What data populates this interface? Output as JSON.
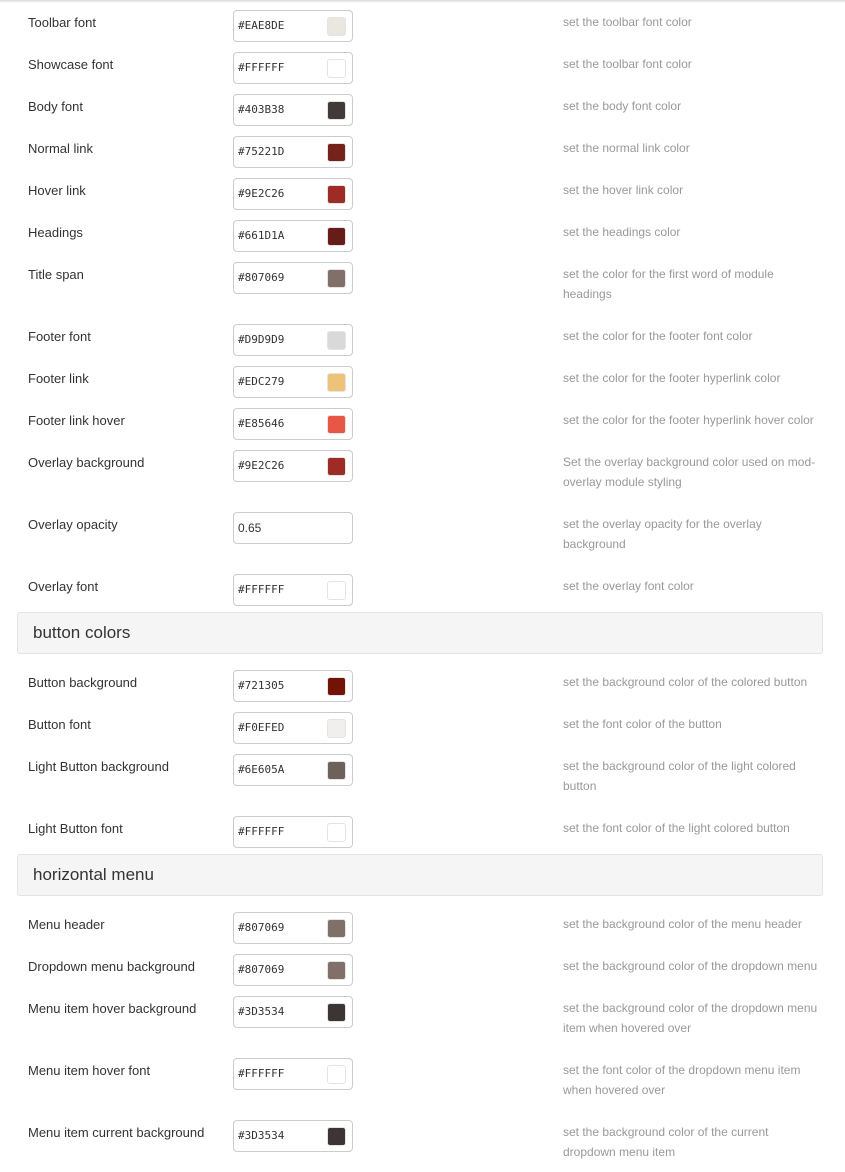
{
  "sections": [
    {
      "title": "",
      "rows": [
        {
          "label": "Toolbar font",
          "value": "#EAE8DE",
          "swatch": "#EAE8DE",
          "desc": "set the toolbar font color"
        },
        {
          "label": "Showcase font",
          "value": "#FFFFFF",
          "swatch": "#FFFFFF",
          "desc": "set the toolbar font color"
        },
        {
          "label": "Body font",
          "value": "#403B38",
          "swatch": "#403B38",
          "desc": "set the body font color"
        },
        {
          "label": "Normal link",
          "value": "#75221D",
          "swatch": "#75221D",
          "desc": "set the normal link color"
        },
        {
          "label": "Hover link",
          "value": "#9E2C26",
          "swatch": "#9E2C26",
          "desc": "set the hover link color"
        },
        {
          "label": "Headings",
          "value": "#661D1A",
          "swatch": "#661D1A",
          "desc": "set the headings color"
        },
        {
          "label": "Title span",
          "value": "#807069",
          "swatch": "#807069",
          "desc": "set the color for the first word of module headings"
        },
        {
          "label": "Footer font",
          "value": "#D9D9D9",
          "swatch": "#D9D9D9",
          "desc": "set the color for the footer font color"
        },
        {
          "label": "Footer link",
          "value": "#EDC279",
          "swatch": "#EDC279",
          "desc": "set the color for the footer hyperlink color"
        },
        {
          "label": "Footer link hover",
          "value": "#E85646",
          "swatch": "#E85646",
          "desc": "set the color for the footer hyperlink hover color"
        },
        {
          "label": "Overlay background",
          "value": "#9E2C26",
          "swatch": "#9E2C26",
          "desc": "Set the overlay background color used on mod-overlay module styling"
        },
        {
          "label": "Overlay opacity",
          "value": "0.65",
          "desc": "set the overlay opacity for the overlay background"
        },
        {
          "label": "Overlay font",
          "value": "#FFFFFF",
          "swatch": "#FFFFFF",
          "desc": "set the overlay font color"
        }
      ]
    },
    {
      "title": "button colors",
      "rows": [
        {
          "label": "Button background",
          "value": "#721305",
          "swatch": "#721305",
          "desc": "set the background color of the colored button"
        },
        {
          "label": "Button font",
          "value": "#F0EFED",
          "swatch": "#F0EFED",
          "desc": "set the font color of the button"
        },
        {
          "label": "Light Button background",
          "value": "#6E605A",
          "swatch": "#6E605A",
          "desc": "set the background color of the light colored button"
        },
        {
          "label": "Light Button font",
          "value": "#FFFFFF",
          "swatch": "#FFFFFF",
          "desc": "set the font color of the light colored button"
        }
      ]
    },
    {
      "title": "horizontal menu",
      "rows": [
        {
          "label": "Menu header",
          "value": "#807069",
          "swatch": "#807069",
          "desc": "set the background color of the menu header"
        },
        {
          "label": "Dropdown menu background",
          "value": "#807069",
          "swatch": "#807069",
          "desc": "set the background color of the dropdown menu"
        },
        {
          "label": "Menu item hover background",
          "value": "#3D3534",
          "swatch": "#3D3534",
          "desc": "set the background color of the dropdown menu item when hovered over"
        },
        {
          "label": "Menu item hover font",
          "value": "#FFFFFF",
          "swatch": "#FFFFFF",
          "desc": "set the font color of the dropdown menu item when hovered over"
        },
        {
          "label": "Menu item current background",
          "value": "#3D3534",
          "swatch": "#3D3534",
          "desc": "set the background color of the current dropdown menu item"
        }
      ]
    }
  ]
}
